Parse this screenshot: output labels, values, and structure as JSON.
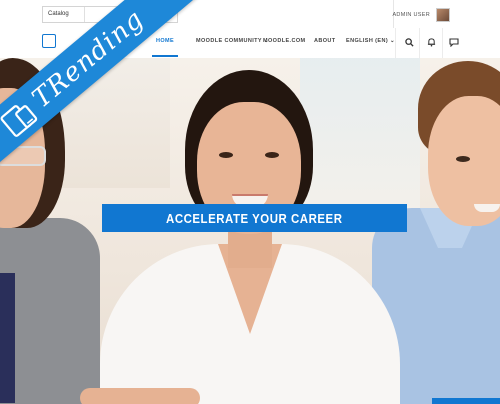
{
  "topbar": {
    "search_category": "Catalog",
    "search_placeholder": "",
    "user_name": "ADMIN USER"
  },
  "nav": {
    "items": [
      {
        "label": "HOME",
        "active": true
      },
      {
        "label": "MOODLE COMMUNITY",
        "dropdown": true
      },
      {
        "label": "MOODLE.COM"
      },
      {
        "label": "ABOUT"
      },
      {
        "label": "ENGLISH (EN)",
        "dropdown": true
      }
    ],
    "icons": [
      "search-icon",
      "bell-icon",
      "chat-icon"
    ]
  },
  "hero": {
    "banner_text": "ACCELERATE YOUR CAREER"
  },
  "ribbon": {
    "text": "TRending",
    "icon": "devices-icon"
  },
  "colors": {
    "accent": "#1177d1",
    "ribbon": "#1e88d8"
  }
}
